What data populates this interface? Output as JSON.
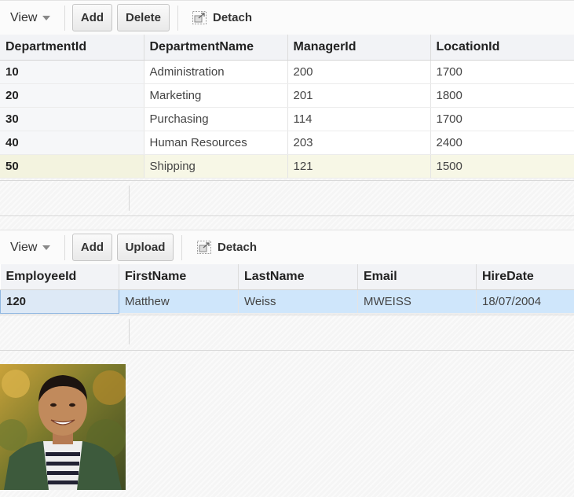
{
  "dept_toolbar": {
    "view_label": "View",
    "add_label": "Add",
    "delete_label": "Delete",
    "detach_label": "Detach"
  },
  "dept_table": {
    "columns": [
      "DepartmentId",
      "DepartmentName",
      "ManagerId",
      "LocationId"
    ],
    "rows": [
      [
        "10",
        "Administration",
        "200",
        "1700"
      ],
      [
        "20",
        "Marketing",
        "201",
        "1800"
      ],
      [
        "30",
        "Purchasing",
        "114",
        "1700"
      ],
      [
        "40",
        "Human Resources",
        "203",
        "2400"
      ],
      [
        "50",
        "Shipping",
        "121",
        "1500"
      ]
    ]
  },
  "emp_toolbar": {
    "view_label": "View",
    "add_label": "Add",
    "upload_label": "Upload",
    "detach_label": "Detach"
  },
  "emp_table": {
    "columns": [
      "EmployeeId",
      "FirstName",
      "LastName",
      "Email",
      "HireDate"
    ],
    "rows": [
      [
        "120",
        "Matthew",
        "Weiss",
        "MWEISS",
        "18/07/2004"
      ]
    ]
  },
  "colors": {
    "selected_row": "#f7f7e6",
    "employee_row": "#cfe6fb"
  }
}
